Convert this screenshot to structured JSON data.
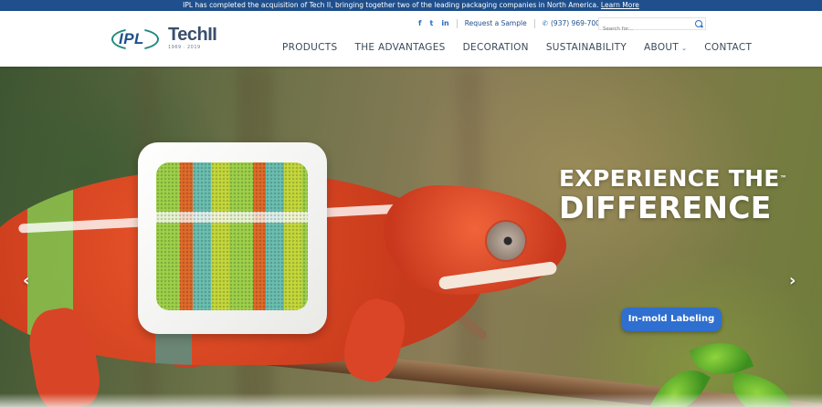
{
  "announcement": {
    "text": "IPL has completed the acquisition of Tech II, bringing together two of the leading packaging companies in North America.",
    "link_label": "Learn More"
  },
  "brand": {
    "ipl_logo_text": "IPL",
    "tech2_logo_text": "TechII",
    "tech2_years": "1969  ·  2019"
  },
  "utility": {
    "social_icons": [
      "facebook-icon",
      "twitter-icon",
      "linkedin-icon"
    ],
    "social_labels": [
      "f",
      "t",
      "in"
    ],
    "request_sample": "Request a Sample",
    "phone": "(937) 969-7000",
    "search_placeholder": "Search for..."
  },
  "nav": {
    "items": [
      "PRODUCTS",
      "THE ADVANTAGES",
      "DECORATION",
      "SUSTAINABILITY",
      "ABOUT",
      "CONTACT"
    ]
  },
  "hero": {
    "headline_line1": "EXPERIENCE THE",
    "headline_tm": "™",
    "headline_line2": "DIFFERENCE",
    "cta_label": "In-mold Labeling",
    "arrow_left": "‹",
    "arrow_right": "›"
  },
  "colors": {
    "announcement_bg": "#1f4f8c",
    "accent_blue": "#2f6fcf",
    "nav_text": "#3b4a5a"
  }
}
